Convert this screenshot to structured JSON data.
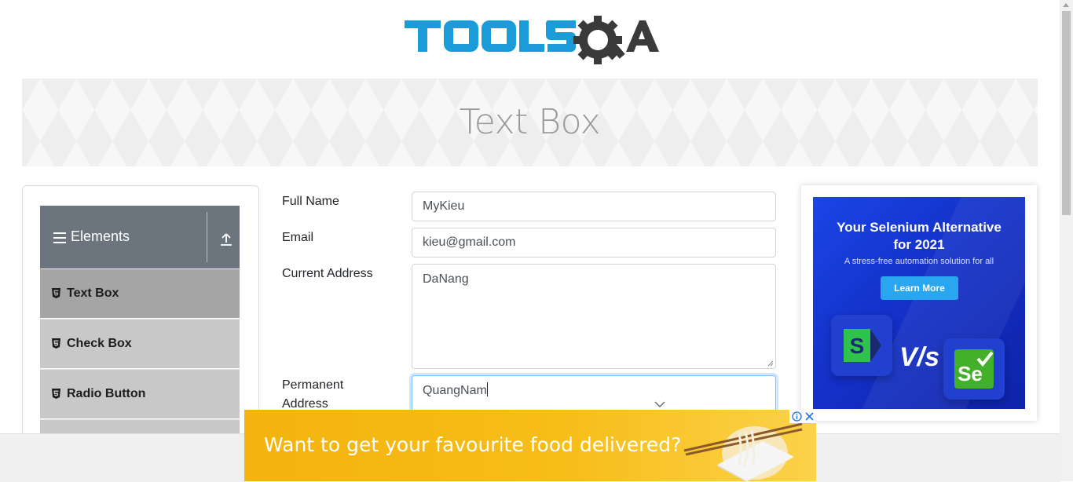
{
  "header": {
    "logo_alt": "TOOLSQA"
  },
  "banner": {
    "title": "Text Box"
  },
  "sidebar": {
    "group_title": "Elements",
    "items": [
      {
        "label": "Text Box",
        "active": true
      },
      {
        "label": "Check Box",
        "active": false
      },
      {
        "label": "Radio Button",
        "active": false
      }
    ]
  },
  "form": {
    "full_name": {
      "label": "Full Name",
      "value": "MyKieu"
    },
    "email": {
      "label": "Email",
      "value": "kieu@gmail.com"
    },
    "current_address": {
      "label": "Current Address",
      "value": "DaNang"
    },
    "permanent_address": {
      "label_line1": "Permanent",
      "label_line2": "Address",
      "value": "QuangNam"
    }
  },
  "side_ad": {
    "title_line1": "Your Selenium Alternative",
    "title_line2": "for 2021",
    "subtitle": "A stress-free automation solution for all",
    "button": "Learn More",
    "vs_text": "V/s"
  },
  "bottom_ad": {
    "text": "Want to get your favourite food delivered?"
  },
  "colors": {
    "logo_blue": "#1b9bd7",
    "logo_dark": "#3a3a3a",
    "menu_header": "#6c757d",
    "menu_active": "#a5a5a5",
    "menu_item": "#c8c8c8",
    "ad_blue": "#1a45e6",
    "food_ad_yellow": "#f4b30f"
  }
}
